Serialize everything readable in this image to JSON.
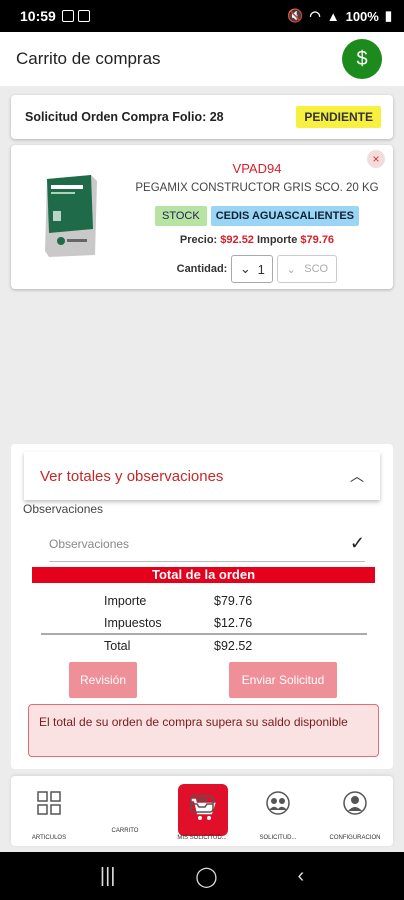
{
  "status_bar": {
    "time": "10:59",
    "battery": "100%"
  },
  "header": {
    "title": "Carrito de compras",
    "dollar_label": "$"
  },
  "folio": {
    "label": "Solicitud Orden Compra Folio: 28",
    "status": "PENDIENTE"
  },
  "product": {
    "sku": "VPAD94",
    "name": "PEGAMIX CONSTRUCTOR GRIS SCO. 20 KG",
    "stock_tag": "STOCK",
    "warehouse_tag": "CEDIS AGUASCALIENTES",
    "price_label": "Precio:",
    "price_value": "$92.52",
    "amount_label": "Importe",
    "amount_value": "$79.76",
    "qty_label": "Cantidad:",
    "qty_value": "1",
    "unit": "SCO",
    "remove_label": "×"
  },
  "totals": {
    "accordion_title": "Ver totales y observaciones",
    "obs_label": "Observaciones",
    "obs_placeholder": "Observaciones",
    "check": "✓",
    "section_title": "Total de la orden",
    "rows": [
      {
        "label": "Importe",
        "value": "$79.76"
      },
      {
        "label": "Impuestos",
        "value": "$12.76"
      },
      {
        "label": "Total",
        "value": "$92.52"
      }
    ],
    "review_button": "Revisión",
    "send_button": "Enviar Solicitud",
    "alert": "El total de su orden de compra supera su saldo disponible"
  },
  "nav": {
    "items": [
      {
        "label": "ARTICULOS",
        "icon": "grid-icon"
      },
      {
        "label": "CARRITO",
        "icon": "cart-icon"
      },
      {
        "label": "MIS SOLICITUD...",
        "icon": "inbox-icon"
      },
      {
        "label": "SOLICITUD...",
        "icon": "users-icon"
      },
      {
        "label": "CONFIGURACION",
        "icon": "user-icon"
      }
    ]
  },
  "colors": {
    "accent": "#e0102a",
    "pending": "#f7f041",
    "dollar": "#1d8a1d"
  }
}
